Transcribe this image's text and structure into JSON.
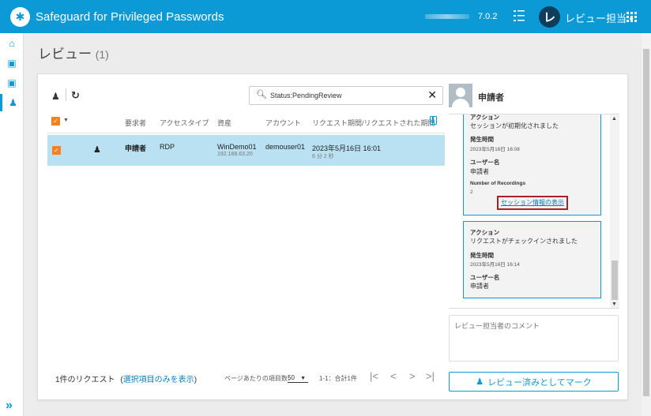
{
  "header": {
    "app_title": "Safeguard for Privileged Passwords",
    "version": "7.0.2",
    "avatar_letter": "レ",
    "user_name": "レビュー担当",
    "user_caret": "▾"
  },
  "leftnav": {
    "items": [
      {
        "icon": "home-icon",
        "glyph": "⌂"
      },
      {
        "icon": "requests-icon",
        "glyph": "▣"
      },
      {
        "icon": "approvals-icon",
        "glyph": "▣"
      },
      {
        "icon": "reviews-icon",
        "glyph": "♟"
      }
    ],
    "expand_glyph": "»"
  },
  "page": {
    "title": "レビュー",
    "count": "(1)"
  },
  "toolbar": {
    "search_value": "Status:PendingReview",
    "clear_glyph": "✕"
  },
  "table": {
    "columns": [
      "要求者",
      "アクセスタイプ",
      "資産",
      "アカウント",
      "リクエスト期間/リクエストされた期間"
    ],
    "rows": [
      {
        "requester": "申請者",
        "access_type": "RDP",
        "asset": "WinDemo01",
        "asset_ip": "192.168.63.20",
        "account": "demouser01",
        "period": "2023年5月16日 16:01",
        "duration": "6 分 2 秒"
      }
    ]
  },
  "footer": {
    "request_count": "1件のリクエスト",
    "show_selected_prefix": "(",
    "show_selected_link": "選択項目のみを表示",
    "show_selected_suffix": ")",
    "per_page_label": "ページあたりの項目数：",
    "per_page_value": "50",
    "range": "1-1：合計1件"
  },
  "right_panel": {
    "title": "申請者",
    "events": [
      {
        "action_label": "アクション",
        "action_value": "セッションが初期化されました",
        "time_label": "発生時間",
        "time_value": "2023年5月16日 16:08",
        "user_label": "ユーザー名",
        "user_value": "申請者",
        "recordings_label": "Number of Recordings",
        "recordings_value": "2",
        "link": "セッション情報の表示"
      },
      {
        "action_label": "アクション",
        "action_value": "リクエストがチェックインされました",
        "time_label": "発生時間",
        "time_value": "2023年5月16日 16:14",
        "user_label": "ユーザー名",
        "user_value": "申請者"
      }
    ],
    "comment_placeholder": "レビュー担当者のコメント",
    "mark_button": "レビュー済みとしてマーク"
  },
  "colors": {
    "brand": "#0b9ad6",
    "checkbox": "#f5821f",
    "selected_row": "#b9e1f1",
    "highlight_border": "#a9202b"
  }
}
